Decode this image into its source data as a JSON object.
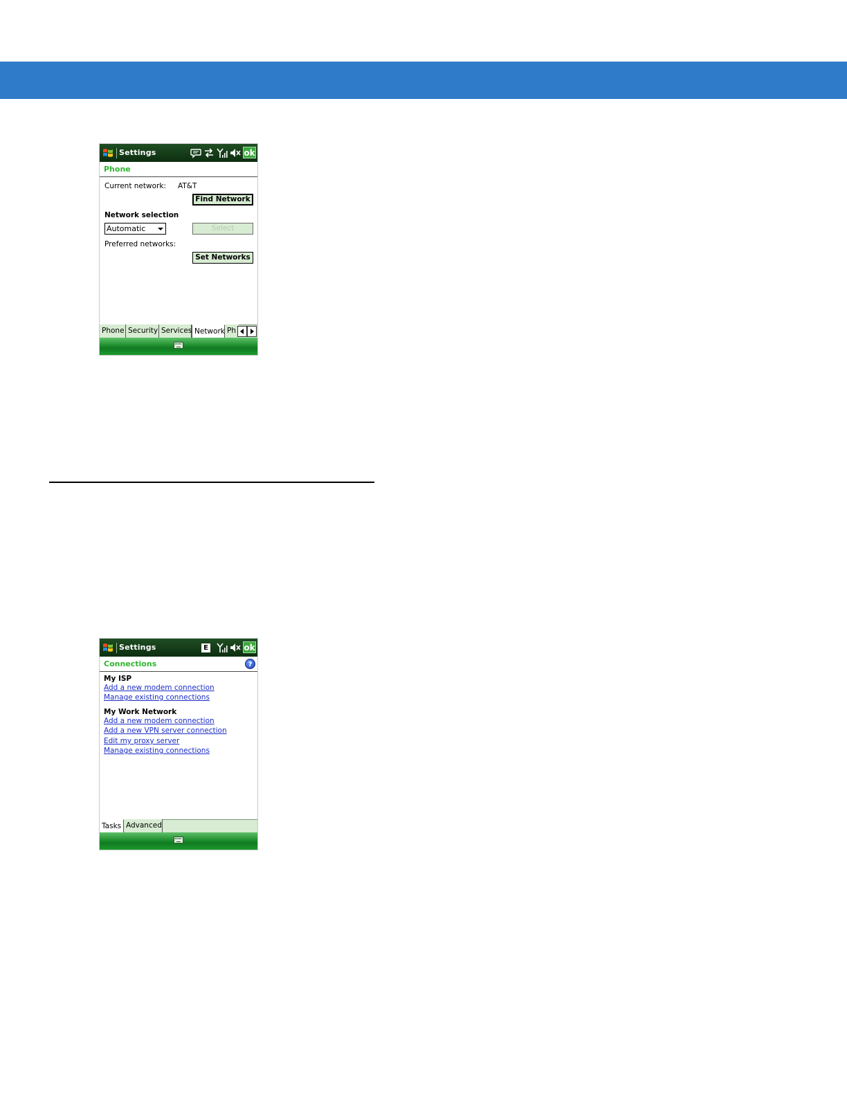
{
  "colors": {
    "header_bar": "#2f7bc9",
    "subheader_green": "#2fb52f",
    "link_blue": "#1a2cc7"
  },
  "screen1": {
    "title": "Settings",
    "ok": "ok",
    "status_icons": [
      "message-bubble-icon",
      "sync-arrows-icon",
      "signal-strength-icon",
      "speaker-muted-icon"
    ],
    "subheader": "Phone",
    "current_network_label": "Current network:",
    "current_network_value": "AT&T",
    "find_network_button": "Find Network",
    "network_selection_label": "Network selection",
    "selection_value": "Automatic",
    "select_button": "Select",
    "preferred_networks_label": "Preferred networks:",
    "set_networks_button": "Set Networks",
    "tabs": [
      "Phone",
      "Security",
      "Services",
      "Network",
      "Ph"
    ]
  },
  "screen2": {
    "title": "Settings",
    "ok": "ok",
    "status_badge": "E",
    "status_icons": [
      "edge-data-icon",
      "signal-strength-icon",
      "speaker-muted-icon"
    ],
    "subheader": "Connections",
    "help": "?",
    "groups": [
      {
        "title": "My ISP",
        "links": [
          "Add a new modem connection",
          "Manage existing connections"
        ]
      },
      {
        "title": "My Work Network",
        "links": [
          "Add a new modem connection",
          "Add a new VPN server connection",
          "Edit my proxy server",
          "Manage existing connections"
        ]
      }
    ],
    "tabs": [
      "Tasks",
      "Advanced"
    ]
  }
}
